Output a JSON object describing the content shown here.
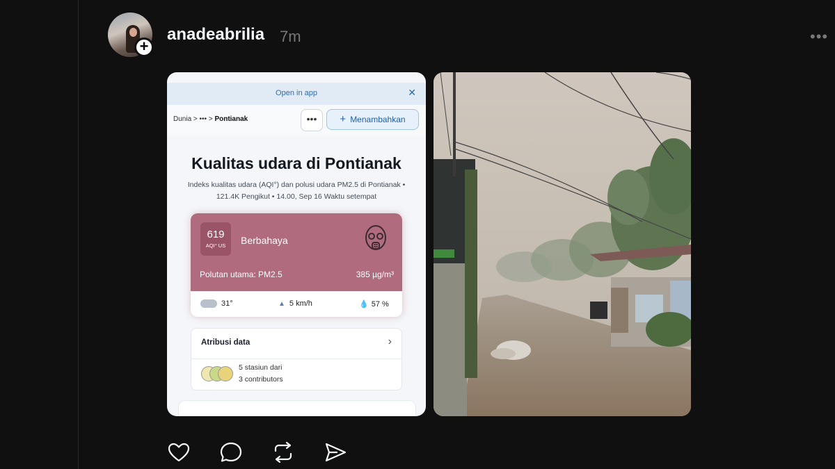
{
  "post": {
    "username": "anadeabrilia",
    "time": "7m",
    "more": "•••"
  },
  "screenshot": {
    "open_in_app": "Open in app",
    "breadcrumb": {
      "root": "Dunia",
      "sep1": " > ••• > ",
      "current": "Pontianak"
    },
    "dots_label": "•••",
    "add_button": "Menambahkan",
    "title": "Kualitas udara di Pontianak",
    "subtitle": "Indeks kualitas udara (AQI°) dan polusi udara PM2.5 di Pontianak • 121.4K Pengikut • 14.00, Sep 16 Waktu setempat",
    "aqi": {
      "value": "619",
      "unit": "AQI° US",
      "level": "Berbahaya",
      "pollutant_label": "Polutan utama: PM2.5",
      "pollutant_value": "385 µg/m³",
      "color": "#b06b7e"
    },
    "weather": {
      "temp": "31°",
      "wind": "5 km/h",
      "humidity": "57 %"
    },
    "attribution": {
      "title": "Atribusi data",
      "stations": "5 stasiun dari",
      "contributors": "3 contributors"
    }
  },
  "icons": {
    "like": "heart-icon",
    "comment": "comment-icon",
    "repost": "repost-icon",
    "share": "share-icon"
  }
}
